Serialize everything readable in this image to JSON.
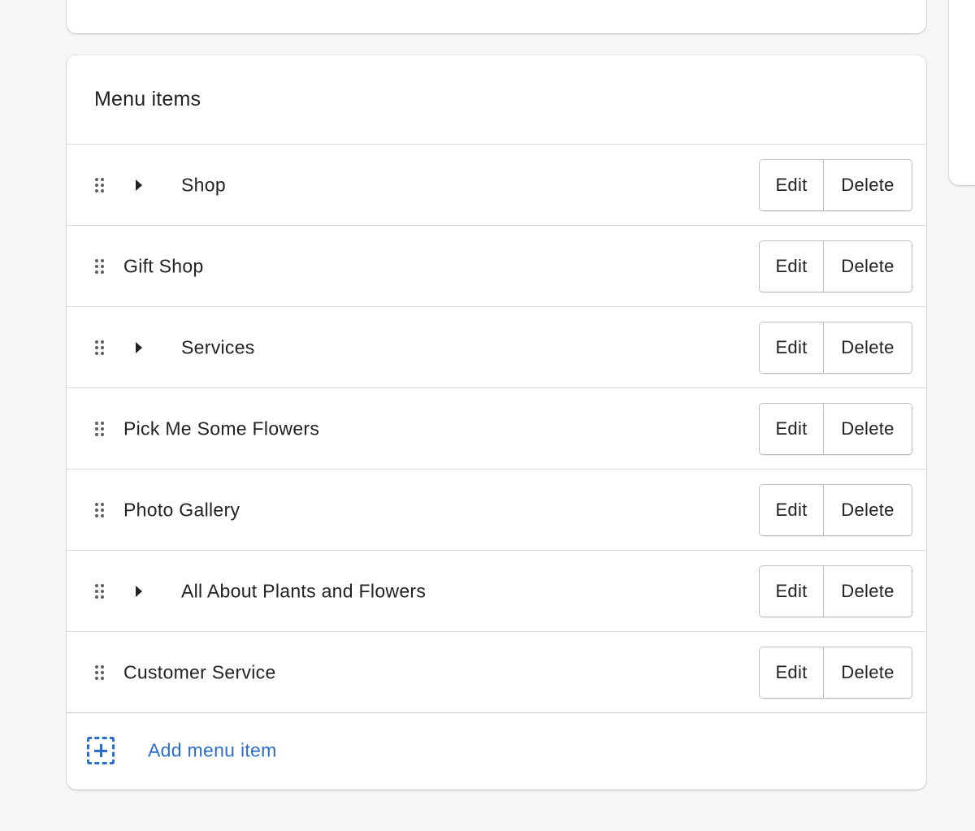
{
  "menu_card": {
    "title": "Menu items",
    "items": [
      {
        "label": "Shop",
        "expandable": true
      },
      {
        "label": "Gift Shop",
        "expandable": false
      },
      {
        "label": "Services",
        "expandable": true
      },
      {
        "label": "Pick Me Some Flowers",
        "expandable": false
      },
      {
        "label": "Photo Gallery",
        "expandable": false
      },
      {
        "label": "All About Plants and Flowers",
        "expandable": true
      },
      {
        "label": "Customer Service",
        "expandable": false
      }
    ],
    "edit_label": "Edit",
    "delete_label": "Delete",
    "add_label": "Add menu item"
  },
  "colors": {
    "link_blue": "#2c6ecb",
    "background": "#f6f6f7",
    "text": "#202223"
  },
  "icons": {
    "drag": "drag-handle-icon",
    "expand": "caret-right-icon",
    "add": "add-dashed-plus-icon"
  }
}
